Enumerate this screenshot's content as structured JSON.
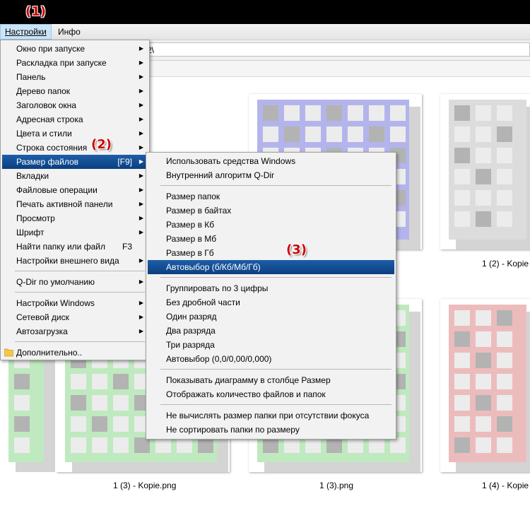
{
  "menubar": {
    "items": [
      {
        "label": "Настройки",
        "active": true
      },
      {
        "label": "Инфо",
        "active": false
      }
    ]
  },
  "address": {
    "value": "2\\"
  },
  "thumbnails": [
    {
      "caption": "",
      "palette": "blue"
    },
    {
      "caption": "1 (2) - Kopie",
      "palette": "gray"
    },
    {
      "caption": "1 (3) - Kopie.png",
      "palette": "green"
    },
    {
      "caption": "1 (3).png",
      "palette": "green"
    },
    {
      "caption": "1 (4) - Kopie",
      "palette": "red"
    }
  ],
  "main_menu": {
    "items": [
      {
        "label": "Окно при запуске",
        "arrow": true
      },
      {
        "label": "Раскладка при запуске",
        "arrow": true
      },
      {
        "label": "Панель",
        "arrow": true
      },
      {
        "label": "Дерево папок",
        "arrow": true
      },
      {
        "label": "Заголовок окна",
        "arrow": true
      },
      {
        "label": "Адресная строка",
        "arrow": true
      },
      {
        "label": "Цвета и стили",
        "arrow": true
      },
      {
        "label": "Строка состояния",
        "arrow": true
      },
      {
        "label": "Размер файлов",
        "shortcut": "[F9]",
        "arrow": true,
        "highlighted": true
      },
      {
        "label": "Вкладки",
        "arrow": true
      },
      {
        "label": "Файловые операции",
        "arrow": true
      },
      {
        "label": "Печать активной панели",
        "arrow": true
      },
      {
        "label": "Просмотр",
        "arrow": true
      },
      {
        "label": "Шрифт",
        "arrow": true
      },
      {
        "label": "Найти папку или файл",
        "shortcut": "F3",
        "arrow": false
      },
      {
        "label": "Настройки внешнего вида",
        "arrow": true
      },
      {
        "label": "Q-Dir по умолчанию",
        "arrow": true
      },
      {
        "label": "Настройки Windows",
        "arrow": true
      },
      {
        "label": "Сетевой диск",
        "arrow": true
      },
      {
        "label": "Автозагрузка",
        "arrow": true
      },
      {
        "label": "Дополнительно..",
        "arrow": false,
        "icon": "folder-icon"
      }
    ]
  },
  "sub_menu": {
    "items": [
      {
        "label": "Использовать средства Windows"
      },
      {
        "label": "Внутренний алгоритм Q-Dir"
      },
      {
        "label": "Размер папок"
      },
      {
        "label": "Размер в байтах"
      },
      {
        "label": "Размер в Кб"
      },
      {
        "label": "Размер в Мб"
      },
      {
        "label": "Размер в Гб"
      },
      {
        "label": "Автовыбор (б/Кб/Мб/Гб)",
        "highlighted": true
      },
      {
        "label": "Группировать по 3 цифры"
      },
      {
        "label": "Без дробной части"
      },
      {
        "label": "Один разряд"
      },
      {
        "label": "Два разряда"
      },
      {
        "label": "Три разряда"
      },
      {
        "label": "Автовыбор (0,0/0,00/0,000)"
      },
      {
        "label": "Показывать диаграмму в столбце Размер"
      },
      {
        "label": "Отображать количество файлов и папок"
      },
      {
        "label": "Не вычислять размер папки при отсутствии фокуса"
      },
      {
        "label": "Не сортировать папки по размеру"
      }
    ]
  },
  "markers": {
    "m1": "(1)",
    "m2": "(2)",
    "m3": "(3)"
  },
  "colors": {
    "highlight": "#0a3f80",
    "marker": "#cc0000",
    "blue_pattern": "#b4b4ec",
    "green_pattern": "#bfe9bf",
    "red_pattern": "#ecbcbc",
    "gray_pattern": "#dcdcdc",
    "cell": "#ececec",
    "dark_cell": "#b3b3b3"
  }
}
